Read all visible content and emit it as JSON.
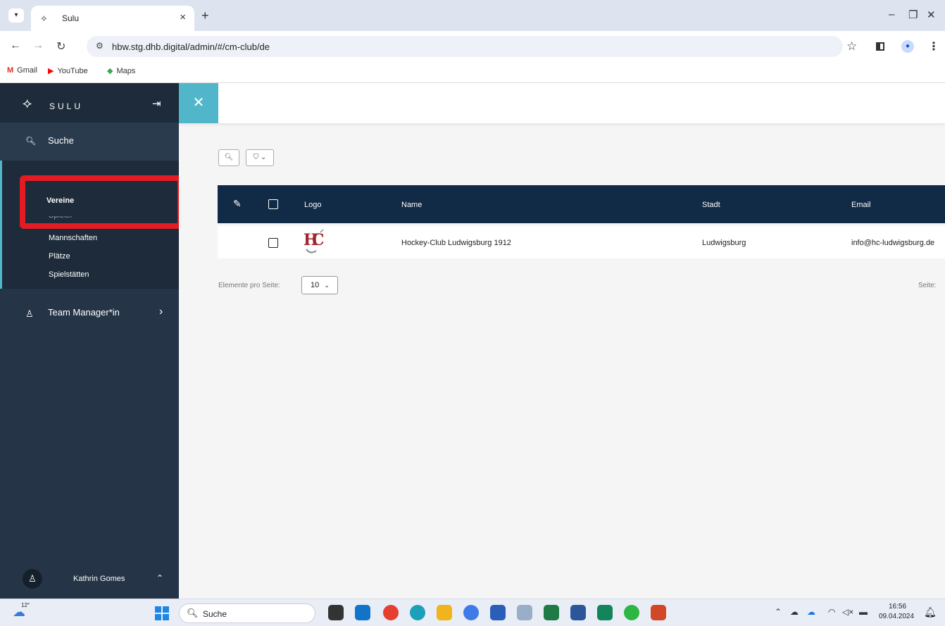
{
  "browser": {
    "tab_title": "Sulu",
    "tab_favicon": "⟡",
    "tab_close": "×",
    "new_tab": "+",
    "url": "hbw.stg.dhb.digital/admin/#/cm-club/de",
    "bookmarks": [
      {
        "label": "Gmail",
        "icon": "M",
        "color": "#d93025"
      },
      {
        "label": "YouTube",
        "icon": "▶",
        "color": "#ff0000"
      },
      {
        "label": "Maps",
        "icon": "◆",
        "color": "#34a853"
      }
    ]
  },
  "sidebar": {
    "logo_text": "SULU",
    "search_label": "Suche",
    "nav_items": [
      {
        "label": "Vereine",
        "active": true
      },
      {
        "label": "Spieler",
        "active": false
      },
      {
        "label": "Mannschaften",
        "active": false
      },
      {
        "label": "Plätze",
        "active": false
      },
      {
        "label": "Spielstätten",
        "active": false
      }
    ],
    "team_manager_label": "Team Manager*in",
    "user_name": "Kathrin Gomes"
  },
  "table": {
    "columns": [
      "Logo",
      "Name",
      "Stadt",
      "Email"
    ],
    "rows": [
      {
        "name": "Hockey-Club Ludwigsburg 1912",
        "city": "Ludwigsburg",
        "email": "info@hc-ludwigsburg.de"
      }
    ]
  },
  "pagination": {
    "per_page_label": "Elemente pro Seite:",
    "per_page_value": "10",
    "page_label": "Seite:"
  },
  "taskbar": {
    "weather_temp": "12°",
    "search_label": "Suche",
    "time": "16:56",
    "date": "09.04.2024"
  },
  "colors": {
    "sidebar_bg": "#253547",
    "accent": "#52b6ca",
    "table_header": "#112a46",
    "highlight_box": "#e31b23"
  }
}
